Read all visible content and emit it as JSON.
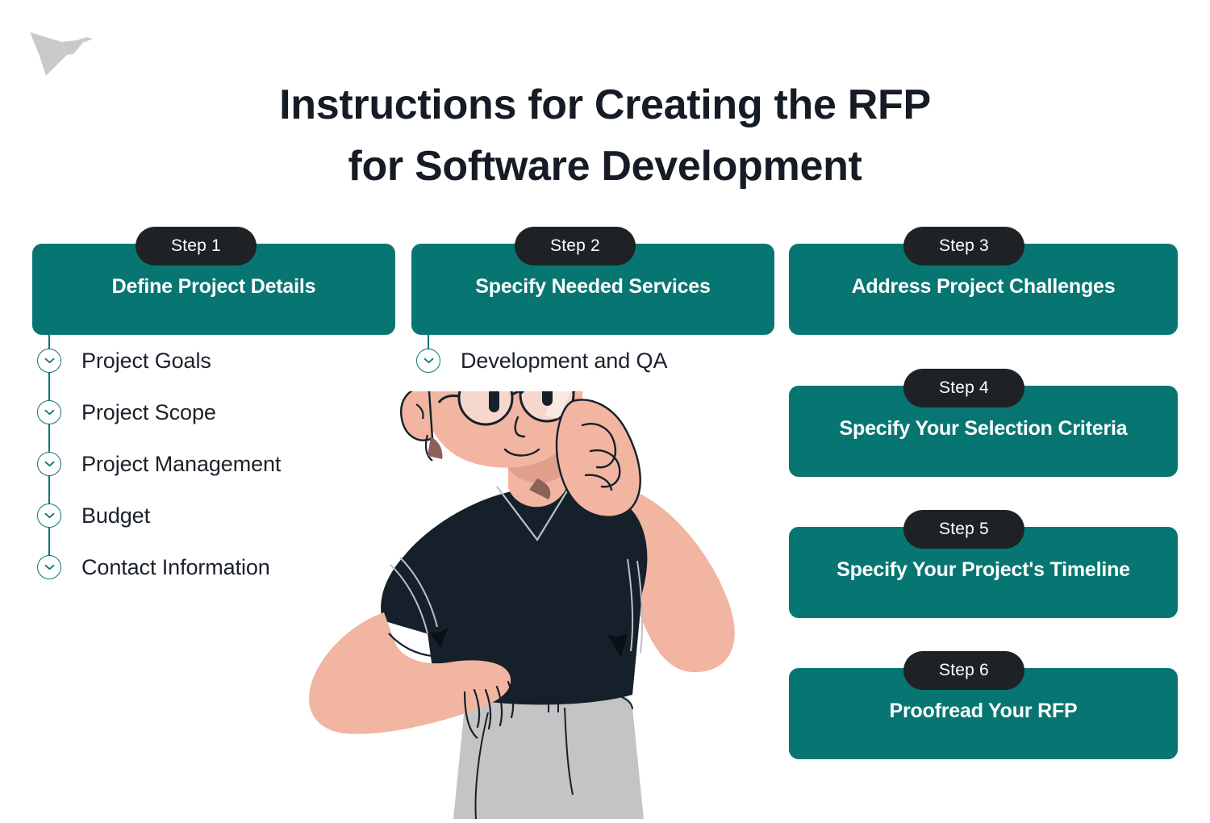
{
  "brand": {
    "logo_icon": "origami-bird-icon",
    "logo_color": "#c9c9c9"
  },
  "title": {
    "line1": "Instructions for Creating the RFP",
    "line2": "for Software Development",
    "color": "#151c25"
  },
  "theme": {
    "card_teal": "#077672",
    "pill_black": "#1f2224",
    "bullet_outline": "#0d7571",
    "text_dark": "#1b212b",
    "card_text": "#ffffff",
    "background": "#ffffff"
  },
  "steps": [
    {
      "pill": "Step 1",
      "title": "Define Project Details",
      "items": [
        {
          "label": "Project Goals",
          "icon": "chevron-down-icon"
        },
        {
          "label": "Project Scope",
          "icon": "chevron-down-icon"
        },
        {
          "label": "Project Management",
          "icon": "chevron-down-icon"
        },
        {
          "label": "Budget",
          "icon": "chevron-down-icon"
        },
        {
          "label": "Contact Information",
          "icon": "chevron-down-icon"
        }
      ]
    },
    {
      "pill": "Step 2",
      "title": "Specify Needed Services",
      "items": [
        {
          "label": "Development and QA",
          "icon": "chevron-down-icon"
        }
      ]
    },
    {
      "pill": "Step 3",
      "title": "Address Project Challenges",
      "items": []
    },
    {
      "pill": "Step 4",
      "title": "Specify Your Selection Criteria",
      "items": []
    },
    {
      "pill": "Step 5",
      "title": "Specify Your Project's Timeline",
      "items": []
    },
    {
      "pill": "Step 6",
      "title": "Proofread Your RFP",
      "items": []
    }
  ],
  "illustration": {
    "name": "thinking-man-illustration",
    "skin": "#f2b5a2",
    "skin_shadow": "#8a6258",
    "hair_shirt": "#16202a",
    "pants": "#c4c4c4",
    "lens": "#f7d7cd",
    "outline": "#16202a"
  }
}
